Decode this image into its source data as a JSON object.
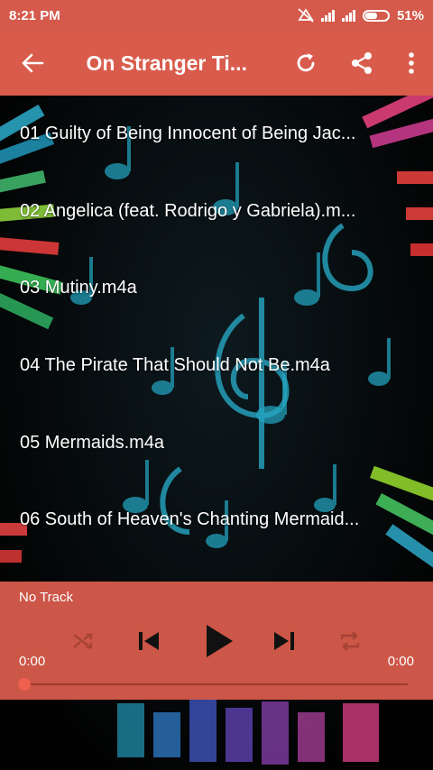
{
  "status_bar": {
    "time": "8:21 PM",
    "battery": "51%"
  },
  "toolbar": {
    "title": "On Stranger Ti..."
  },
  "tracks": [
    "01 Guilty of Being Innocent of Being Jac...",
    "02 Angelica (feat. Rodrigo y Gabriela).m...",
    "03 Mutiny.m4a",
    "04 The Pirate That Should Not Be.m4a",
    "05 Mermaids.m4a",
    "06 South of Heaven's Chanting Mermaid..."
  ],
  "player": {
    "now_playing": "No Track",
    "elapsed": "0:00",
    "duration": "0:00",
    "progress": 0
  },
  "colors": {
    "accent": "#d95b4c",
    "player": "#dc5c4c"
  },
  "icons": [
    "back-arrow-icon",
    "refresh-icon",
    "share-icon",
    "more-vert-icon",
    "shuffle-icon",
    "skip-previous-icon",
    "play-icon",
    "skip-next-icon",
    "repeat-icon"
  ]
}
